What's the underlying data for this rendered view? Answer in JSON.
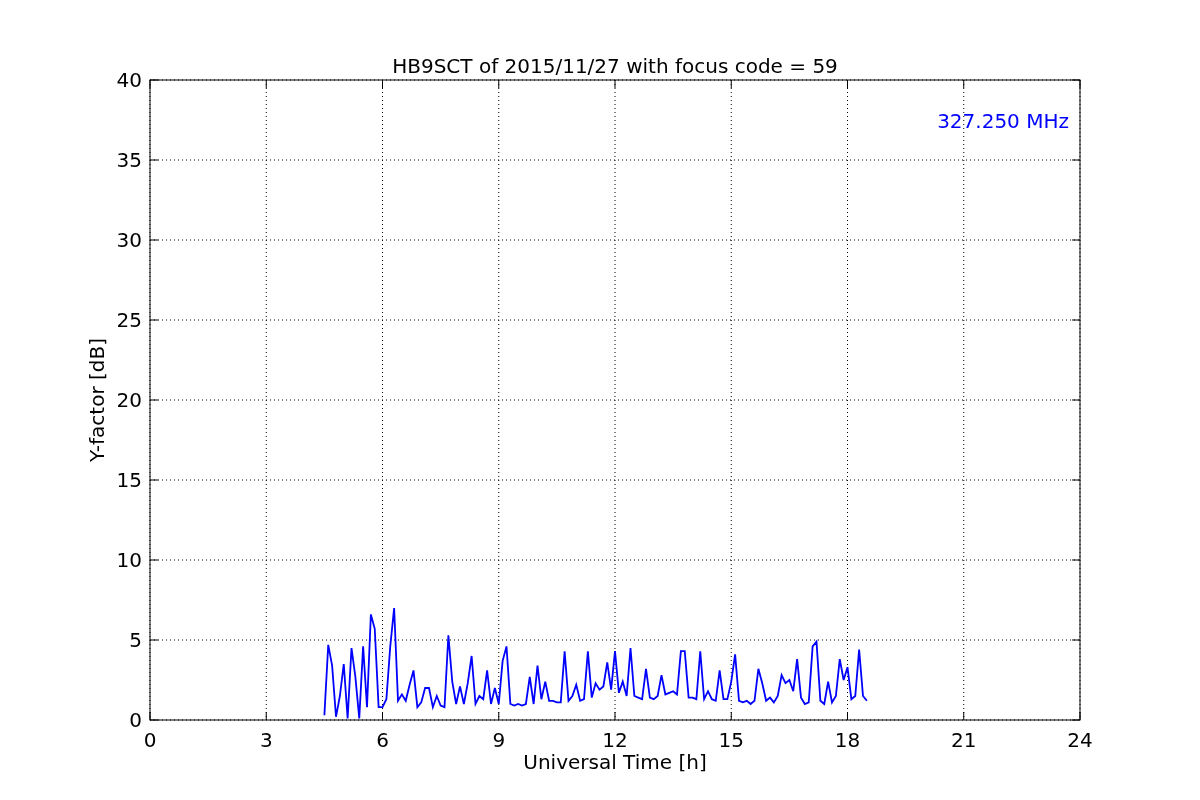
{
  "chart_data": {
    "type": "line",
    "title": "HB9SCT of 2015/11/27 with focus code = 59",
    "xlabel": "Universal Time [h]",
    "ylabel": "Y-factor [dB]",
    "xlim": [
      0,
      24
    ],
    "ylim": [
      0,
      40
    ],
    "xticks": [
      0,
      3,
      6,
      9,
      12,
      15,
      18,
      21,
      24
    ],
    "yticks": [
      0,
      5,
      10,
      15,
      20,
      25,
      30,
      35,
      40
    ],
    "x": [
      4.5,
      4.6,
      4.7,
      4.8,
      4.9,
      5.0,
      5.1,
      5.2,
      5.3,
      5.4,
      5.5,
      5.6,
      5.7,
      5.8,
      5.9,
      6.0,
      6.1,
      6.2,
      6.3,
      6.4,
      6.5,
      6.6,
      6.7,
      6.8,
      6.9,
      7.0,
      7.1,
      7.2,
      7.3,
      7.4,
      7.5,
      7.6,
      7.7,
      7.8,
      7.9,
      8.0,
      8.1,
      8.2,
      8.3,
      8.4,
      8.5,
      8.6,
      8.7,
      8.8,
      8.9,
      9.0,
      9.1,
      9.2,
      9.3,
      9.4,
      9.5,
      9.6,
      9.7,
      9.8,
      9.9,
      10.0,
      10.1,
      10.2,
      10.3,
      10.4,
      10.5,
      10.6,
      10.7,
      10.8,
      10.9,
      11.0,
      11.1,
      11.2,
      11.3,
      11.4,
      11.5,
      11.6,
      11.7,
      11.8,
      11.9,
      12.0,
      12.1,
      12.2,
      12.3,
      12.4,
      12.5,
      12.6,
      12.7,
      12.8,
      12.9,
      13.0,
      13.1,
      13.2,
      13.3,
      13.4,
      13.5,
      13.6,
      13.7,
      13.8,
      13.9,
      14.0,
      14.1,
      14.2,
      14.3,
      14.4,
      14.5,
      14.6,
      14.7,
      14.8,
      14.9,
      15.0,
      15.1,
      15.2,
      15.3,
      15.4,
      15.5,
      15.6,
      15.7,
      15.8,
      15.9,
      16.0,
      16.1,
      16.2,
      16.3,
      16.4,
      16.5,
      16.6,
      16.7,
      16.8,
      16.9,
      17.0,
      17.1,
      17.2,
      17.3,
      17.4,
      17.5,
      17.6,
      17.7,
      17.8,
      17.9,
      18.0,
      18.1,
      18.2,
      18.3,
      18.4,
      18.5
    ],
    "series": [
      {
        "name": "327.250 MHz",
        "color": "#0000ff",
        "values": [
          0.3,
          4.7,
          3.4,
          0.2,
          1.5,
          3.5,
          0.1,
          4.5,
          2.7,
          0.1,
          4.6,
          0.8,
          6.6,
          5.7,
          0.8,
          0.8,
          1.3,
          4.6,
          7.0,
          1.2,
          1.6,
          1.2,
          2.2,
          3.1,
          0.8,
          1.1,
          2.0,
          2.0,
          0.8,
          1.5,
          0.9,
          0.8,
          5.3,
          2.4,
          1.0,
          2.1,
          1.0,
          2.3,
          4.0,
          1.0,
          1.5,
          1.3,
          3.1,
          1.0,
          2.0,
          1.0,
          3.7,
          4.6,
          1.0,
          0.9,
          1.0,
          0.9,
          1.0,
          2.7,
          1.0,
          3.4,
          1.3,
          2.4,
          1.2,
          1.2,
          1.1,
          1.1,
          4.3,
          1.2,
          1.5,
          2.2,
          1.2,
          1.3,
          4.3,
          1.4,
          2.3,
          1.9,
          2.1,
          3.6,
          1.9,
          4.3,
          1.7,
          2.4,
          1.5,
          4.5,
          1.5,
          1.4,
          1.3,
          3.2,
          1.4,
          1.3,
          1.5,
          2.8,
          1.6,
          1.7,
          1.8,
          1.6,
          4.3,
          4.3,
          1.4,
          1.4,
          1.3,
          4.3,
          1.3,
          1.8,
          1.3,
          1.2,
          3.1,
          1.3,
          1.3,
          2.4,
          4.1,
          1.2,
          1.1,
          1.2,
          1.0,
          1.2,
          3.2,
          2.3,
          1.2,
          1.4,
          1.1,
          1.5,
          2.8,
          2.3,
          2.5,
          1.8,
          3.8,
          1.4,
          1.0,
          1.1,
          4.6,
          4.9,
          1.2,
          1.0,
          2.4,
          1.1,
          1.5,
          3.8,
          2.5,
          3.3,
          1.3,
          1.5,
          4.4,
          1.5,
          1.2
        ]
      }
    ],
    "grid": true
  }
}
